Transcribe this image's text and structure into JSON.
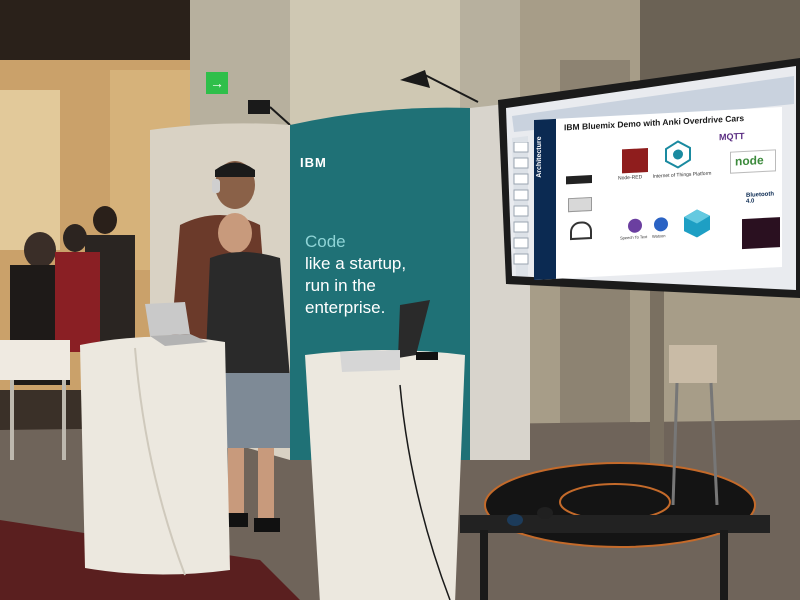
{
  "booth": {
    "logo": "IBM",
    "headline_1": "Code",
    "headline_2": "like a startup,",
    "headline_3": "run in the",
    "headline_4": "enterprise.",
    "exit_sign": "→"
  },
  "slide": {
    "title": "IBM Bluemix Demo with Anki Overdrive Cars",
    "sidebar_label": "Architecture",
    "node_red": "Node-RED",
    "iot_platform": "Internet of Things Platform",
    "mqtt": "MQTT",
    "nodejs": "node",
    "bluetooth": "Bluetooth 4.0",
    "speech": "Speech To Text",
    "watson": "Watson",
    "colors": {
      "sidebar": "#0b2a52",
      "node_red_red": "#8f1d1d",
      "iot_teal": "#1a8aa0",
      "node_green": "#3c8a3c"
    }
  },
  "colors": {
    "banner_teal": "#1e6f73",
    "wall": "#b9b3a4",
    "floor_carpet": "#5a1f1f",
    "pedestal": "#e8e4dc"
  }
}
